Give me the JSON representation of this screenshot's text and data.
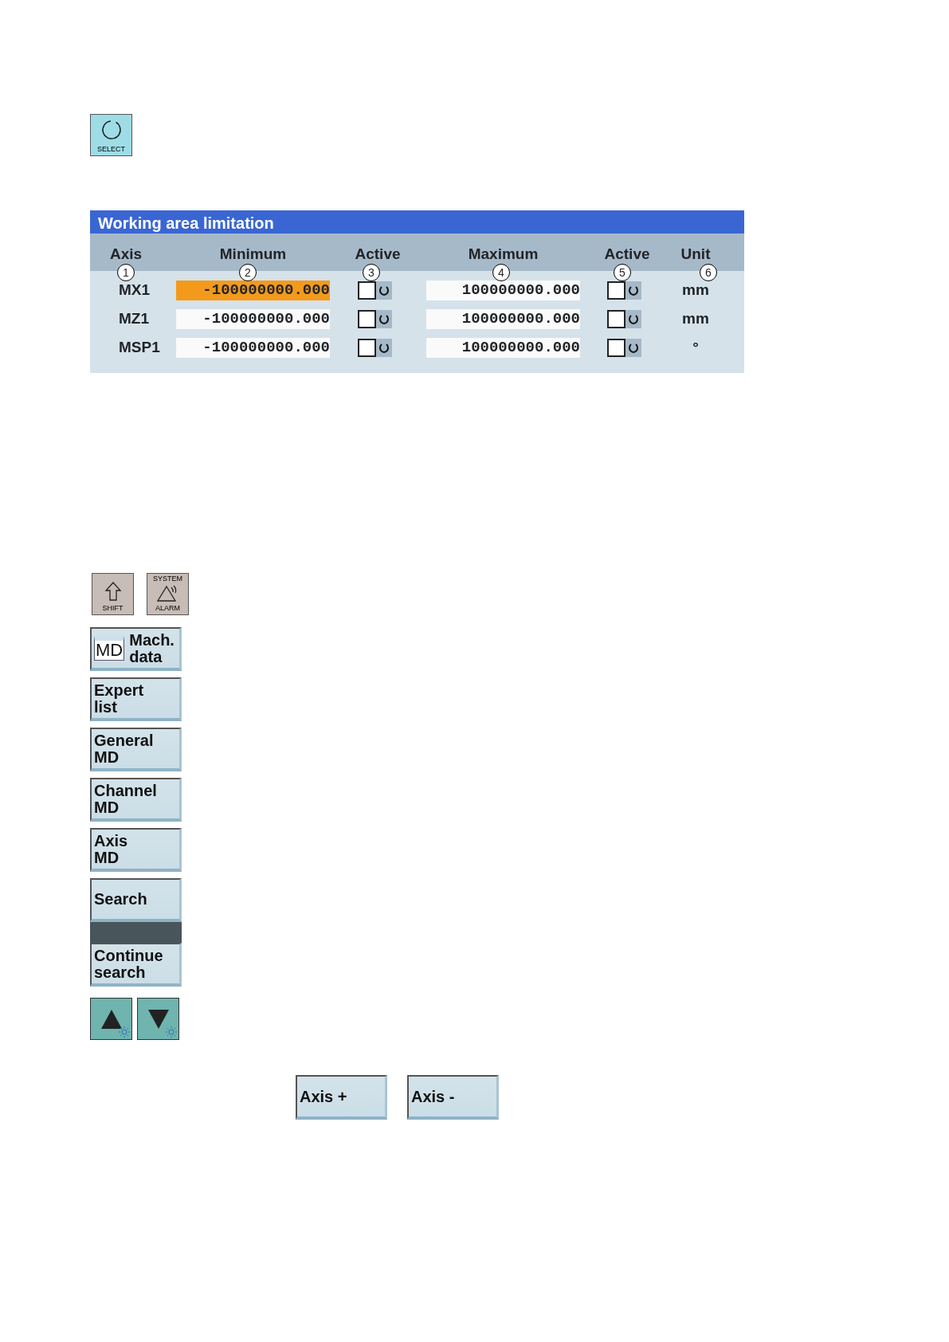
{
  "select_key": {
    "label": "SELECT"
  },
  "panel": {
    "title": "Working area limitation",
    "columns": [
      {
        "label": "Axis",
        "marker": "1"
      },
      {
        "label": "Minimum",
        "marker": "2"
      },
      {
        "label": "Active",
        "marker": "3"
      },
      {
        "label": "Maximum",
        "marker": "4"
      },
      {
        "label": "Active",
        "marker": "5"
      },
      {
        "label": "Unit",
        "marker": "6"
      }
    ],
    "rows": [
      {
        "axis": "MX1",
        "minimum": {
          "value": "-100000000.000",
          "selected": true
        },
        "min_active": {
          "checked": false
        },
        "maximum": {
          "value": "100000000.000",
          "selected": false
        },
        "max_active": {
          "checked": false
        },
        "unit": "mm"
      },
      {
        "axis": "MZ1",
        "minimum": {
          "value": "-100000000.000",
          "selected": false
        },
        "min_active": {
          "checked": false
        },
        "maximum": {
          "value": "100000000.000",
          "selected": false
        },
        "max_active": {
          "checked": false
        },
        "unit": "mm"
      },
      {
        "axis": "MSP1",
        "minimum": {
          "value": "-100000000.000",
          "selected": false
        },
        "min_active": {
          "checked": false
        },
        "maximum": {
          "value": "100000000.000",
          "selected": false
        },
        "max_active": {
          "checked": false
        },
        "unit": "°"
      }
    ]
  },
  "keys": [
    {
      "kind": "shift",
      "label": "SHIFT"
    },
    {
      "kind": "alarm",
      "top_label": "SYSTEM",
      "label": "ALARM"
    }
  ],
  "softkeys": [
    {
      "kind": "md",
      "label": "Mach.\ndata",
      "icon_label": "MD"
    },
    {
      "kind": "text",
      "label": "Expert\nlist"
    },
    {
      "kind": "text",
      "label": "General\nMD"
    },
    {
      "kind": "text",
      "label": "Channel\nMD"
    },
    {
      "kind": "text",
      "label": "Axis\nMD"
    },
    {
      "kind": "text",
      "label": "Search"
    },
    {
      "kind": "separator"
    },
    {
      "kind": "text",
      "label": "Continue\nsearch"
    }
  ],
  "arrow_keys": [
    {
      "kind": "up"
    },
    {
      "kind": "down"
    }
  ],
  "axis_buttons": [
    {
      "label": "Axis +"
    },
    {
      "label": "Axis -"
    }
  ]
}
